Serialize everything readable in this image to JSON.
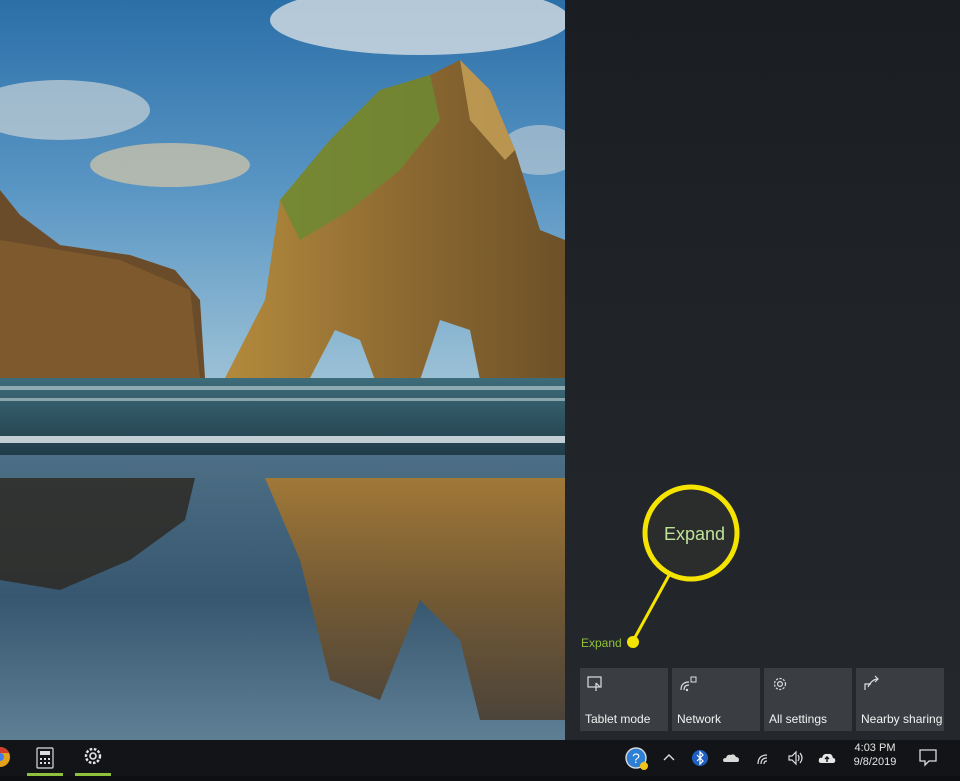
{
  "action_center": {
    "expand_label": "Expand",
    "tiles": [
      {
        "label": "Tablet mode",
        "icon": "tablet-mode-icon"
      },
      {
        "label": "Network",
        "icon": "network-icon"
      },
      {
        "label": "All settings",
        "icon": "gear-icon"
      },
      {
        "label": "Nearby sharing",
        "icon": "nearby-sharing-icon"
      }
    ]
  },
  "callout": {
    "text": "Expand",
    "color": "#f5e400"
  },
  "taskbar": {
    "pinned": [
      "chrome-icon",
      "calculator-icon",
      "settings-gear-icon"
    ],
    "tray_icons": [
      "help-icon",
      "chevron-up-icon",
      "bluetooth-icon",
      "onedrive-icon",
      "wifi-icon",
      "volume-icon",
      "cloud-upload-icon"
    ],
    "time": "4:03 PM",
    "date": "9/8/2019",
    "notifications_icon": "action-center-icon"
  }
}
